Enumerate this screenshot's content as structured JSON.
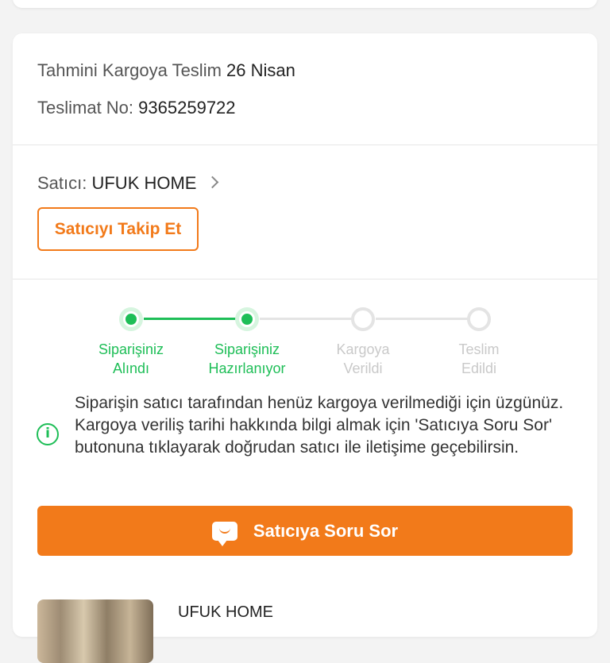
{
  "delivery": {
    "estimate_label": "Tahmini Kargoya Teslim",
    "estimate_value": "26 Nisan",
    "number_label": "Teslimat No:",
    "number_value": "9365259722"
  },
  "seller": {
    "label": "Satıcı:",
    "name": "UFUK HOME",
    "follow_button": "Satıcıyı Takip Et"
  },
  "progress": {
    "steps": [
      {
        "line1": "Siparişiniz",
        "line2": "Alındı",
        "done": true
      },
      {
        "line1": "Siparişiniz",
        "line2": "Hazırlanıyor",
        "done": true
      },
      {
        "line1": "Kargoya",
        "line2": "Verildi",
        "done": false
      },
      {
        "line1": "Teslim",
        "line2": "Edildi",
        "done": false
      }
    ]
  },
  "info": {
    "icon": "info-icon",
    "text": "Siparişin satıcı tarafından henüz kargoya verilmediği için üzgünüz. Kargoya veriliş tarihi hakkında bilgi almak için 'Satıcıya Soru Sor' butonuna tıklayarak doğrudan satıcı ile iletişime geçebilirsin."
  },
  "ask_button": {
    "icon": "chat-smile-icon",
    "label": "Satıcıya Soru Sor"
  },
  "product": {
    "seller": "UFUK HOME"
  },
  "colors": {
    "accent": "#f27a1a",
    "success": "#1ebe57",
    "pending": "#e4e4e4"
  }
}
